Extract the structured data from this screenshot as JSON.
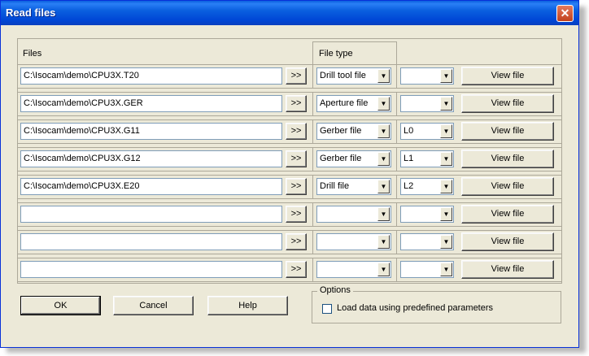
{
  "window": {
    "title": "Read files"
  },
  "headers": {
    "files": "Files",
    "file_type": "File type"
  },
  "browse_label": ">>",
  "view_label": "View file",
  "rows": [
    {
      "path": "C:\\Isocam\\demo\\CPU3X.T20",
      "type": "Drill tool file",
      "layer": ""
    },
    {
      "path": "C:\\Isocam\\demo\\CPU3X.GER",
      "type": "Aperture file",
      "layer": ""
    },
    {
      "path": "C:\\Isocam\\demo\\CPU3X.G11",
      "type": "Gerber file",
      "layer": "L0"
    },
    {
      "path": "C:\\Isocam\\demo\\CPU3X.G12",
      "type": "Gerber file",
      "layer": "L1"
    },
    {
      "path": "C:\\Isocam\\demo\\CPU3X.E20",
      "type": "Drill file",
      "layer": "L2"
    },
    {
      "path": "",
      "type": "",
      "layer": ""
    },
    {
      "path": "",
      "type": "",
      "layer": ""
    },
    {
      "path": "",
      "type": "",
      "layer": ""
    }
  ],
  "buttons": {
    "ok": "OK",
    "cancel": "Cancel",
    "help": "Help"
  },
  "options": {
    "title": "Options",
    "load_predefined": "Load data using predefined parameters",
    "load_predefined_checked": false
  },
  "icons": {
    "close": "close-icon",
    "dropdown": "chevron-down-icon"
  },
  "colors": {
    "titlebar": "#0a5fdf",
    "close": "#c1401c",
    "face": "#ece9d8"
  }
}
